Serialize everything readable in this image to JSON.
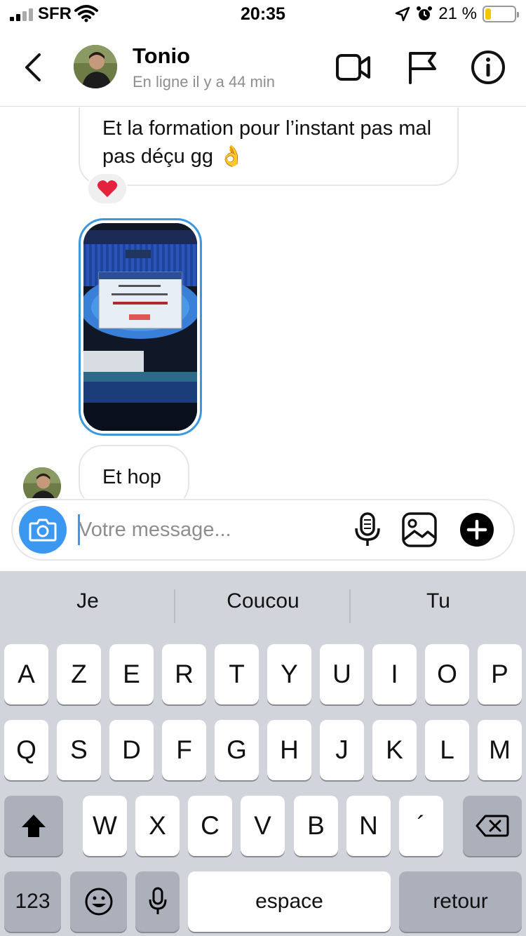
{
  "status_bar": {
    "carrier": "SFR",
    "time": "20:35",
    "battery_percent": "21 %",
    "battery_level": 0.21,
    "icons": [
      "signal-icon",
      "wifi-icon",
      "location-icon",
      "alarm-icon",
      "battery-icon"
    ]
  },
  "header": {
    "contact_name": "Tonio",
    "contact_status": "En ligne il y a 44 min",
    "icons": [
      "back-icon",
      "video-call-icon",
      "flag-icon",
      "info-icon"
    ]
  },
  "messages": [
    {
      "type": "text",
      "text": "Et la formation pour l’instant pas mal pas déçu gg 👌",
      "reaction": "❤️"
    },
    {
      "type": "image",
      "description_icon": "screenshot-thumbnail"
    },
    {
      "type": "text",
      "text": "Et hop"
    }
  ],
  "composer": {
    "placeholder": "Votre message...",
    "icons": [
      "camera-icon",
      "microphone-icon",
      "gallery-icon",
      "plus-icon"
    ]
  },
  "keyboard": {
    "suggestions": [
      "Je",
      "Coucou",
      "Tu"
    ],
    "row1": [
      "A",
      "Z",
      "E",
      "R",
      "T",
      "Y",
      "U",
      "I",
      "O",
      "P"
    ],
    "row2": [
      "Q",
      "S",
      "D",
      "F",
      "G",
      "H",
      "J",
      "K",
      "L",
      "M"
    ],
    "row3": [
      "W",
      "X",
      "C",
      "V",
      "B",
      "N",
      "´"
    ],
    "numbers_key": "123",
    "space_key": "espace",
    "return_key": "retour"
  },
  "colors": {
    "accent": "#3b97f0",
    "battery": "#f2c700",
    "keyboard_bg": "#d1d4da",
    "reaction_bg": "#efefef"
  }
}
